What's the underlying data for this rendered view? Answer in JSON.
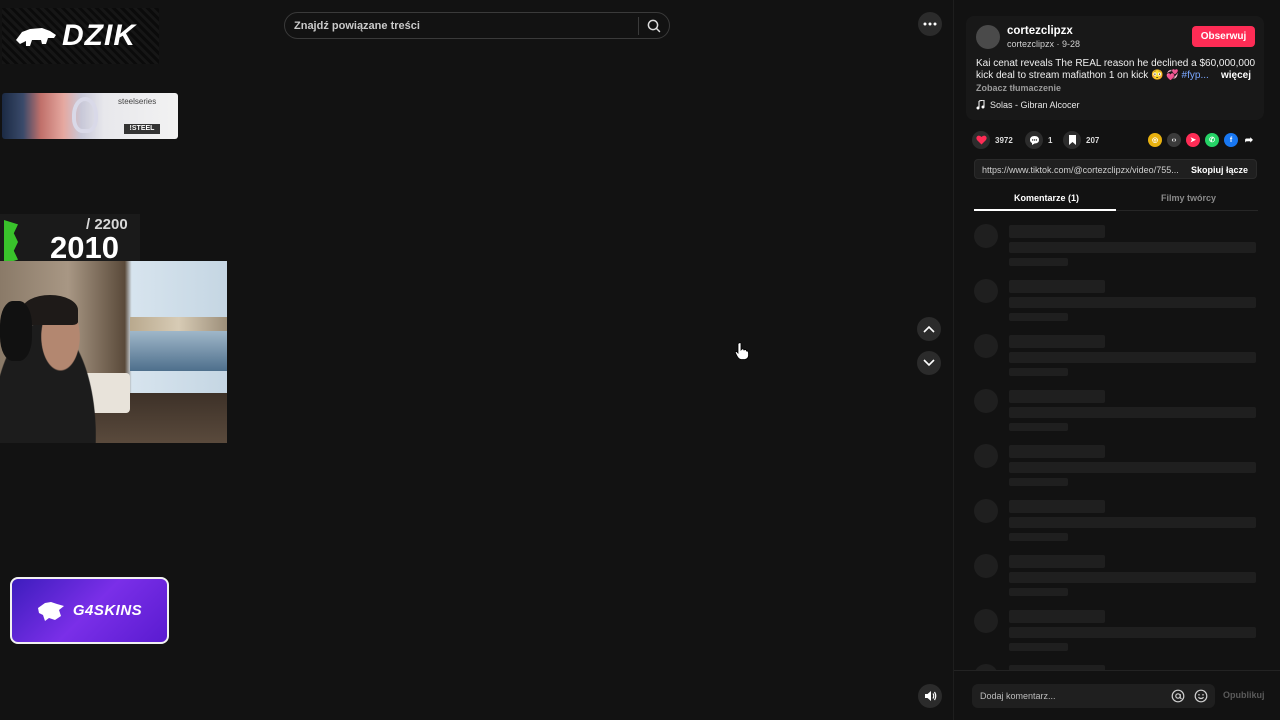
{
  "stream_overlay": {
    "logo_text": "DZIK",
    "steel_banner": {
      "brand": "steelseries",
      "tag": "!STEEL"
    },
    "counter": {
      "goal": "/ 2200",
      "current": "2010"
    },
    "g4_banner": {
      "text": "G4SKINS"
    }
  },
  "search": {
    "placeholder": "Znajdź powiązane treści"
  },
  "icons": {
    "search": "search-icon",
    "more": "more-horizontal-icon",
    "up": "chevron-up-icon",
    "down": "chevron-down-icon",
    "volume": "volume-icon",
    "music": "music-note-icon",
    "heart": "heart-icon",
    "comment": "comment-icon",
    "bookmark": "bookmark-icon"
  },
  "post": {
    "username": "cortezclipzx",
    "handle_date": "cortezclipzx · 9-28",
    "follow_label": "Obserwuj",
    "description": "Kai cenat reveals The REAL reason he declined a $60,000,000 kick deal to stream mafiathon 1 on kick 😳 💞",
    "hashtag": "#fyp...",
    "more_label": "więcej",
    "translate_label": "Zobacz tłumaczenie",
    "music": "Solas - Gibran Alcocer"
  },
  "stats": {
    "likes": "3972",
    "comments": "1",
    "saves": "207"
  },
  "share": [
    {
      "name": "coin-share-icon",
      "color": "#e8b10f",
      "glyph": "◎"
    },
    {
      "name": "embed-share-icon",
      "color": "#3a3a3a",
      "glyph": "‹›"
    },
    {
      "name": "send-share-icon",
      "color": "#fe2c55",
      "glyph": "➤"
    },
    {
      "name": "whatsapp-share-icon",
      "color": "#25d366",
      "glyph": "✆"
    },
    {
      "name": "facebook-share-icon",
      "color": "#1877f2",
      "glyph": "f"
    },
    {
      "name": "forward-share-icon",
      "color": "transparent",
      "glyph": "➦"
    }
  ],
  "link": {
    "url": "https://www.tiktok.com/@cortezclipzx/video/755...",
    "copy_label": "Skopiuj łącze"
  },
  "tabs": [
    {
      "label": "Komentarze (1)"
    },
    {
      "label": "Filmy twórcy"
    }
  ],
  "comment_box": {
    "placeholder": "Dodaj komentarz...",
    "publish_label": "Opublikuj"
  },
  "colors": {
    "accent": "#fe2c55",
    "background": "#121212"
  }
}
